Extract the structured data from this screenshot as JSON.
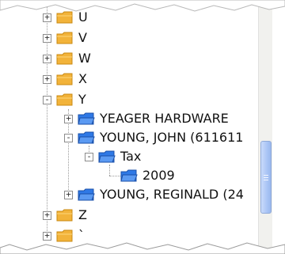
{
  "tree": {
    "items": [
      {
        "label": "U",
        "icon": "yellow-folder-icon",
        "expander": "+"
      },
      {
        "label": "V",
        "icon": "yellow-folder-icon",
        "expander": "+"
      },
      {
        "label": "W",
        "icon": "yellow-folder-icon",
        "expander": "+"
      },
      {
        "label": "X",
        "icon": "yellow-folder-icon",
        "expander": "+"
      },
      {
        "label": "Y",
        "icon": "yellow-folder-icon",
        "expander": "-"
      },
      {
        "label": "YEAGER HARDWARE",
        "icon": "blue-folder-icon",
        "expander": "+"
      },
      {
        "label": "YOUNG, JOHN (611611",
        "icon": "blue-folder-icon",
        "expander": "-"
      },
      {
        "label": "Tax",
        "icon": "blue-folder-icon",
        "expander": "-"
      },
      {
        "label": "2009",
        "icon": "blue-folder-icon",
        "expander": ""
      },
      {
        "label": "YOUNG, REGINALD (24",
        "icon": "blue-folder-icon",
        "expander": "+"
      },
      {
        "label": "Z",
        "icon": "yellow-folder-icon",
        "expander": "+"
      },
      {
        "label": "`",
        "icon": "yellow-folder-icon",
        "expander": "+"
      }
    ]
  },
  "colors": {
    "yellow_folder": "#f2b33a",
    "blue_folder": "#2f79e6",
    "scroll_thumb": "#aac5f5"
  }
}
